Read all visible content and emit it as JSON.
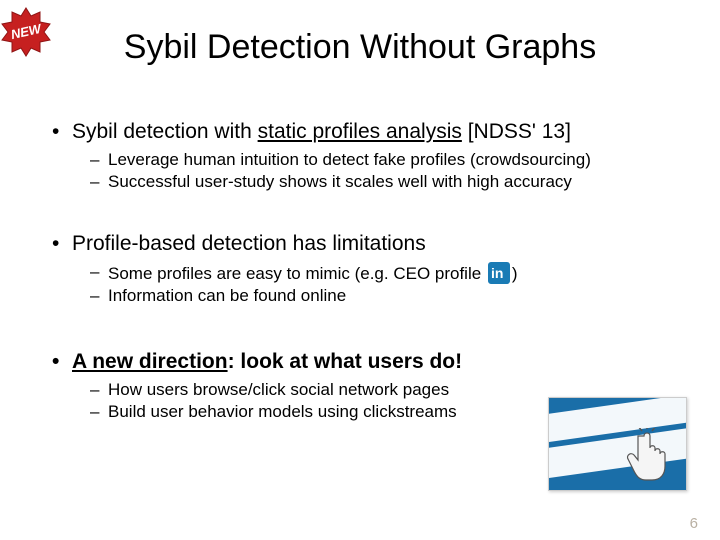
{
  "badge": {
    "text": "NEW"
  },
  "title": "Sybil Detection Without Graphs",
  "sections": [
    {
      "bullet_pre": "Sybil detection with ",
      "bullet_underline": "static profiles analysis",
      "bullet_post": " [NDSS' 13]",
      "subs": [
        "Leverage human intuition to detect fake profiles (crowdsourcing)",
        "Successful user-study shows it scales well with high accuracy"
      ]
    },
    {
      "bullet": "Profile-based detection has limitations",
      "sub_inline_pre": "Some profiles are easy to mimic (e.g. CEO profile ",
      "sub_inline_post": ")",
      "subs_rest": [
        "Information can be found online"
      ]
    },
    {
      "bold_underline": "A new direction",
      "bold_post": ": look at what users do!",
      "subs": [
        "How users browse/click social network pages",
        "Build user behavior models using clickstreams"
      ]
    }
  ],
  "linkedin_icon": "in",
  "page_number": "6"
}
